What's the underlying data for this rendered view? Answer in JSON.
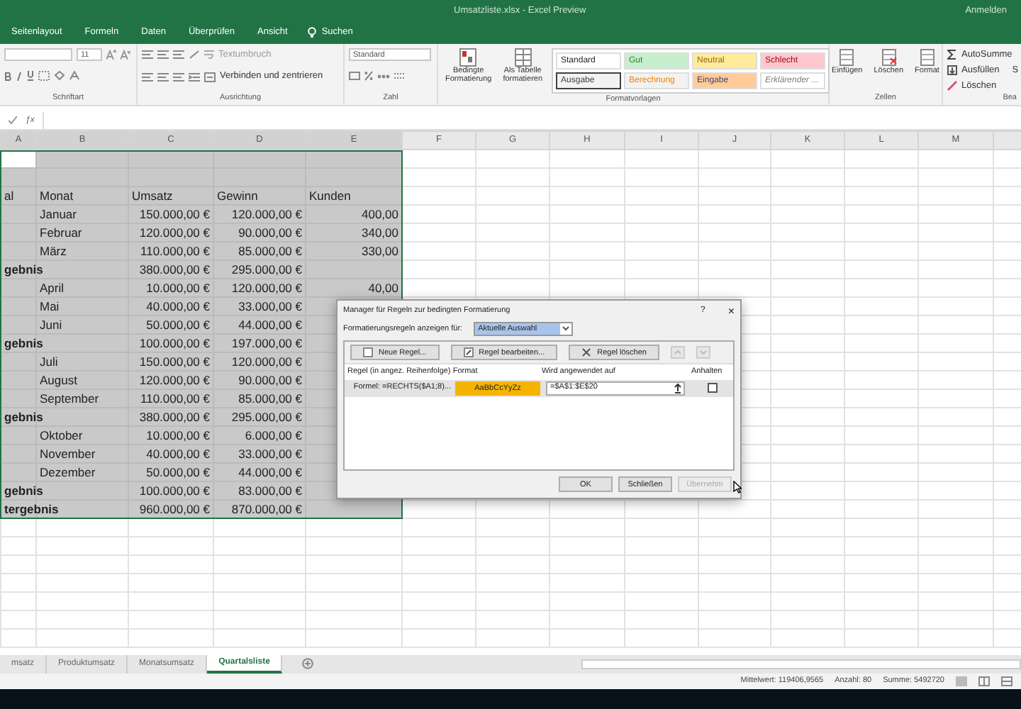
{
  "window": {
    "title": "Umsatzliste.xlsx - Excel Preview",
    "account": "Anmelden"
  },
  "ribbon_tabs": [
    {
      "label": "Seitenlayout",
      "selected": false
    },
    {
      "label": "Formeln",
      "selected": false
    },
    {
      "label": "Daten",
      "selected": false
    },
    {
      "label": "Überprüfen",
      "selected": false
    },
    {
      "label": "Ansicht",
      "selected": false
    }
  ],
  "search": {
    "label": "Suchen"
  },
  "ribbon": {
    "font_size": "11",
    "wrap_text": "Textumbruch",
    "merge": "Verbinden und zentrieren",
    "number_format": "Standard",
    "conditional": "Bedingte Formatierung",
    "as_table": "Als Tabelle formatieren",
    "styles": [
      {
        "label": "Standard",
        "color": "#ffffff",
        "kind": "normal"
      },
      {
        "label": "Gut",
        "color": "#c6efce",
        "kind": "good"
      },
      {
        "label": "Neutral",
        "color": "#ffeb9c",
        "kind": "neutral"
      },
      {
        "label": "Schlecht",
        "color": "#ffc7ce",
        "kind": "bad"
      },
      {
        "label": "Ausgabe",
        "color": "#f2f2f2",
        "kind": "output"
      },
      {
        "label": "Berechnung",
        "color": "#f2f2f2",
        "kind": "calc"
      },
      {
        "label": "Eingabe",
        "color": "#ffcc99",
        "kind": "input"
      },
      {
        "label": "Erklärender ...",
        "color": "#ffffff",
        "kind": "note"
      }
    ],
    "cells": [
      "Einfügen",
      "Löschen",
      "Format"
    ],
    "editing": [
      "AutoSumme",
      "Ausfüllen",
      "Löschen"
    ],
    "cut_button": "S",
    "groups": [
      "Schriftart",
      "Ausrichtung",
      "Zahl",
      "Formatvorlagen",
      "Zellen",
      "Bea"
    ]
  },
  "formula_bar": {
    "function_label": "ƒx"
  },
  "sheet": {
    "columns": [
      "A",
      "B",
      "C",
      "D",
      "E",
      "F",
      "G",
      "H",
      "I",
      "J",
      "K",
      "L",
      "M"
    ],
    "rows": [
      {
        "kind": "active",
        "selected": true,
        "cells": [
          "",
          "",
          "",
          "",
          ""
        ]
      },
      {
        "kind": "blank",
        "selected": true,
        "cells": [
          "",
          "",
          "",
          "",
          ""
        ]
      },
      {
        "kind": "header",
        "selected": true,
        "cells": [
          "al",
          "Monat",
          "Umsatz",
          "Gewinn",
          "Kunden"
        ]
      },
      {
        "kind": "data",
        "selected": true,
        "cells": [
          "",
          "Januar",
          "150.000,00 €",
          "120.000,00 €",
          "400,00"
        ]
      },
      {
        "kind": "data",
        "selected": true,
        "cells": [
          "",
          "Februar",
          "120.000,00 €",
          "90.000,00 €",
          "340,00"
        ]
      },
      {
        "kind": "data",
        "selected": true,
        "cells": [
          "",
          "März",
          "110.000,00 €",
          "85.000,00 €",
          "330,00"
        ]
      },
      {
        "kind": "subtotal",
        "selected": true,
        "cells": [
          "gebnis",
          "",
          "380.000,00 €",
          "295.000,00 €",
          ""
        ]
      },
      {
        "kind": "data",
        "selected": true,
        "cells": [
          "",
          "April",
          "10.000,00 €",
          "120.000,00 €",
          "40,00"
        ]
      },
      {
        "kind": "data",
        "selected": true,
        "cells": [
          "",
          "Mai",
          "40.000,00 €",
          "33.000,00 €",
          ""
        ]
      },
      {
        "kind": "data",
        "selected": true,
        "cells": [
          "",
          "Juni",
          "50.000,00 €",
          "44.000,00 €",
          ""
        ]
      },
      {
        "kind": "subtotal",
        "selected": true,
        "cells": [
          "gebnis",
          "",
          "100.000,00 €",
          "197.000,00 €",
          ""
        ]
      },
      {
        "kind": "data",
        "selected": true,
        "cells": [
          "",
          "Juli",
          "150.000,00 €",
          "120.000,00 €",
          ""
        ]
      },
      {
        "kind": "data",
        "selected": true,
        "cells": [
          "",
          "August",
          "120.000,00 €",
          "90.000,00 €",
          ""
        ]
      },
      {
        "kind": "data",
        "selected": true,
        "cells": [
          "",
          "September",
          "110.000,00 €",
          "85.000,00 €",
          ""
        ]
      },
      {
        "kind": "subtotal",
        "selected": true,
        "cells": [
          "gebnis",
          "",
          "380.000,00 €",
          "295.000,00 €",
          ""
        ]
      },
      {
        "kind": "data",
        "selected": true,
        "cells": [
          "",
          "Oktober",
          "10.000,00 €",
          "6.000,00 €",
          ""
        ]
      },
      {
        "kind": "data",
        "selected": true,
        "cells": [
          "",
          "November",
          "40.000,00 €",
          "33.000,00 €",
          ""
        ]
      },
      {
        "kind": "data",
        "selected": true,
        "cells": [
          "",
          "Dezember",
          "50.000,00 €",
          "44.000,00 €",
          ""
        ]
      },
      {
        "kind": "subtotal",
        "selected": true,
        "cells": [
          "gebnis",
          "",
          "100.000,00 €",
          "83.000,00 €",
          ""
        ]
      },
      {
        "kind": "subtotal",
        "selected": true,
        "cells": [
          "tergebnis",
          "",
          "960.000,00 €",
          "870.000,00 €",
          ""
        ]
      }
    ]
  },
  "dialog": {
    "title": "Manager für Regeln zur bedingten Formatierung",
    "help": "?",
    "close": "×",
    "show_label": "Formatierungsregeln anzeigen für:",
    "show_value": "Aktuelle Auswahl",
    "toolbar": [
      {
        "label": "Neue Regel...",
        "disabled": false
      },
      {
        "label": "Regel bearbeiten...",
        "disabled": false
      },
      {
        "label": "Regel löschen",
        "disabled": false
      }
    ],
    "columns": [
      "Regel (in angez. Reihenfolge)",
      "Format",
      "Wird angewendet auf",
      "Anhalten"
    ],
    "rules": [
      {
        "rule": "Formel: =RECHTS($A1;8)...",
        "preview": "AaBbCcYyZz",
        "applies_to": "=$A$1:$E$20",
        "stop": false
      }
    ],
    "buttons": [
      {
        "label": "OK",
        "disabled": false
      },
      {
        "label": "Schließen",
        "disabled": false
      },
      {
        "label": "Übernehm",
        "disabled": true
      }
    ]
  },
  "sheet_tabs": [
    {
      "label": "msatz",
      "selected": false
    },
    {
      "label": "Produktumsatz",
      "selected": false
    },
    {
      "label": "Monatsumsatz",
      "selected": false
    },
    {
      "label": "Quartalsliste",
      "selected": true
    }
  ],
  "status_bar": [
    "Mittelwert: 119406,9565",
    "Anzahl: 80",
    "Summe: 5492720"
  ]
}
